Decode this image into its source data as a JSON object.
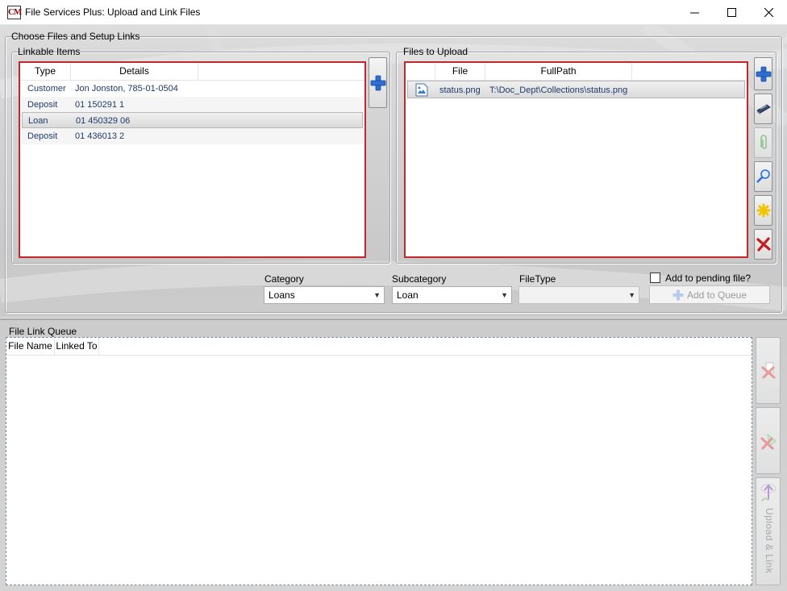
{
  "window": {
    "title": "File Services Plus: Upload and Link Files",
    "icon_text": "CM",
    "icons": [
      "app-icon",
      "minimize-icon",
      "maximize-icon",
      "close-icon"
    ]
  },
  "setup_group": {
    "label": "Choose Files and Setup Links"
  },
  "linkable": {
    "label": "Linkable Items",
    "columns": [
      "Type",
      "Details"
    ],
    "rows": [
      {
        "type": "Customer",
        "details": "Jon Jonston, 785-01-0504"
      },
      {
        "type": "Deposit",
        "details": "01 150291 1"
      },
      {
        "type": "Loan",
        "details": "01 450329 06",
        "selected": true
      },
      {
        "type": "Deposit",
        "details": "01 436013 2"
      }
    ],
    "add_icon": "add-plus-icon"
  },
  "files": {
    "label": "Files to Upload",
    "columns": [
      "File",
      "FullPath"
    ],
    "rows": [
      {
        "file": "status.png",
        "fullpath": "T:\\Doc_Dept\\Collections\\status.png",
        "icon": "image-file-icon"
      }
    ],
    "toolbar_icons": [
      "add-plus-icon",
      "scanner-icon",
      "paperclip-icon",
      "magnifier-icon",
      "asterisk-icon",
      "delete-x-icon"
    ]
  },
  "options": {
    "category_label": "Category",
    "category_value": "Loans",
    "subcategory_label": "Subcategory",
    "subcategory_value": "Loan",
    "filetype_label": "FileType",
    "filetype_value": "",
    "pending_label": "Add to pending file?",
    "add_to_queue_label": "Add to Queue"
  },
  "queue": {
    "label": "File Link Queue",
    "columns": [
      "File Name",
      "Linked To"
    ],
    "upload_link_label": "Upload & Link",
    "side_icons": [
      "remove-link-icon",
      "remove-item-icon",
      "upload-link-icon"
    ]
  },
  "colors": {
    "accent_border": "#c1272d",
    "row_text": "#1f3a6b",
    "plus_blue": "#2f6fd1"
  }
}
